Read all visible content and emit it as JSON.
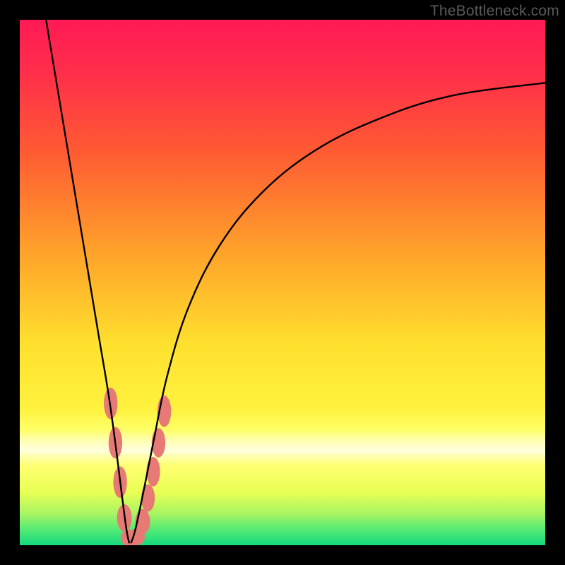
{
  "watermark": "TheBottleneck.com",
  "chart_data": {
    "type": "line",
    "title": "",
    "xlabel": "",
    "ylabel": "",
    "xlim": [
      0,
      100
    ],
    "ylim": [
      0,
      100
    ],
    "background_gradient": {
      "top": "#ff1a4b",
      "mid_upper": "#ff6a2f",
      "mid": "#ffe533",
      "lower_band": "#ffff99",
      "bottom": "#18e07a"
    },
    "series": [
      {
        "name": "left-arm",
        "x": [
          5,
          7,
          9,
          11,
          13,
          15,
          17,
          18.5,
          19.5,
          20.3,
          20.8
        ],
        "y": [
          100,
          88,
          76,
          64,
          52,
          40,
          28,
          17,
          9,
          3,
          0.5
        ]
      },
      {
        "name": "right-arm",
        "x": [
          21.2,
          22,
          23.5,
          25.5,
          28,
          32,
          38,
          46,
          56,
          68,
          82,
          100
        ],
        "y": [
          0.5,
          3,
          10,
          20,
          32,
          45,
          57,
          67,
          75,
          81,
          85.5,
          88
        ]
      }
    ],
    "markers": {
      "name": "data-blobs",
      "color": "#e77a74",
      "points": [
        {
          "x": 17.3,
          "y": 27.0,
          "rx": 1.3,
          "ry": 3.0
        },
        {
          "x": 18.2,
          "y": 19.5,
          "rx": 1.3,
          "ry": 3.0
        },
        {
          "x": 19.1,
          "y": 12.0,
          "rx": 1.3,
          "ry": 3.0
        },
        {
          "x": 19.9,
          "y": 5.2,
          "rx": 1.4,
          "ry": 2.6
        },
        {
          "x": 20.8,
          "y": 1.4,
          "rx": 1.6,
          "ry": 1.6
        },
        {
          "x": 22.2,
          "y": 1.6,
          "rx": 1.6,
          "ry": 1.6
        },
        {
          "x": 23.4,
          "y": 4.5,
          "rx": 1.4,
          "ry": 2.4
        },
        {
          "x": 24.4,
          "y": 9.0,
          "rx": 1.3,
          "ry": 2.6
        },
        {
          "x": 25.4,
          "y": 14.0,
          "rx": 1.3,
          "ry": 2.8
        },
        {
          "x": 26.4,
          "y": 19.5,
          "rx": 1.3,
          "ry": 2.8
        },
        {
          "x": 27.5,
          "y": 25.5,
          "rx": 1.3,
          "ry": 3.0
        }
      ]
    }
  }
}
